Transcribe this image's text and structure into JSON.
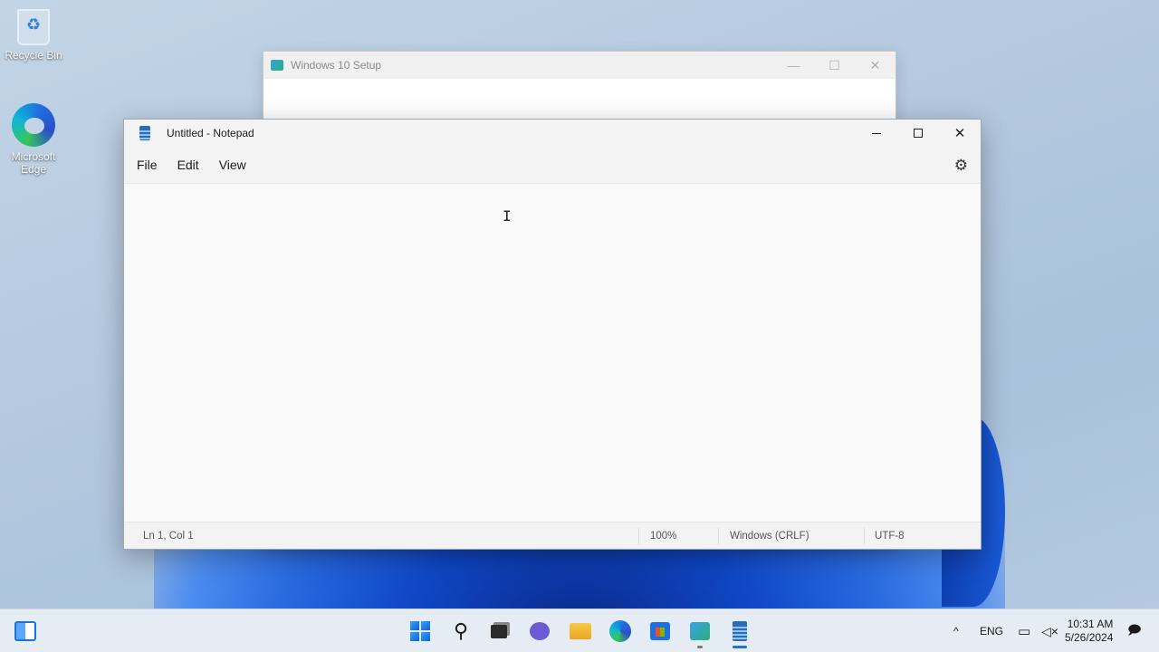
{
  "desktop": {
    "icons": [
      {
        "label": "Recycle Bin"
      },
      {
        "label": "Microsoft Edge"
      }
    ]
  },
  "setup_window": {
    "title": "Windows 10 Setup",
    "minimize": "—",
    "maximize": "☐",
    "close": "✕"
  },
  "notepad": {
    "title": "Untitled - Notepad",
    "menu": {
      "file": "File",
      "edit": "Edit",
      "view": "View"
    },
    "settings_icon": "⚙",
    "close_glyph": "✕",
    "content": "",
    "caret": "I",
    "status": {
      "position": "Ln 1, Col 1",
      "zoom": "100%",
      "line_ending": "Windows (CRLF)",
      "encoding": "UTF-8"
    }
  },
  "taskbar": {
    "apps": [
      "widgets",
      "start",
      "search",
      "task-view",
      "chat",
      "file-explorer",
      "edge",
      "store",
      "windows-setup",
      "notepad"
    ],
    "tray": {
      "chevron": "^",
      "language": "ENG",
      "time": "10:31 AM",
      "date": "5/26/2024"
    }
  },
  "colors": {
    "accent": "#1a73d9",
    "taskbar_bg": "#e6ecf3",
    "notepad_bg": "#f9f9f9"
  }
}
